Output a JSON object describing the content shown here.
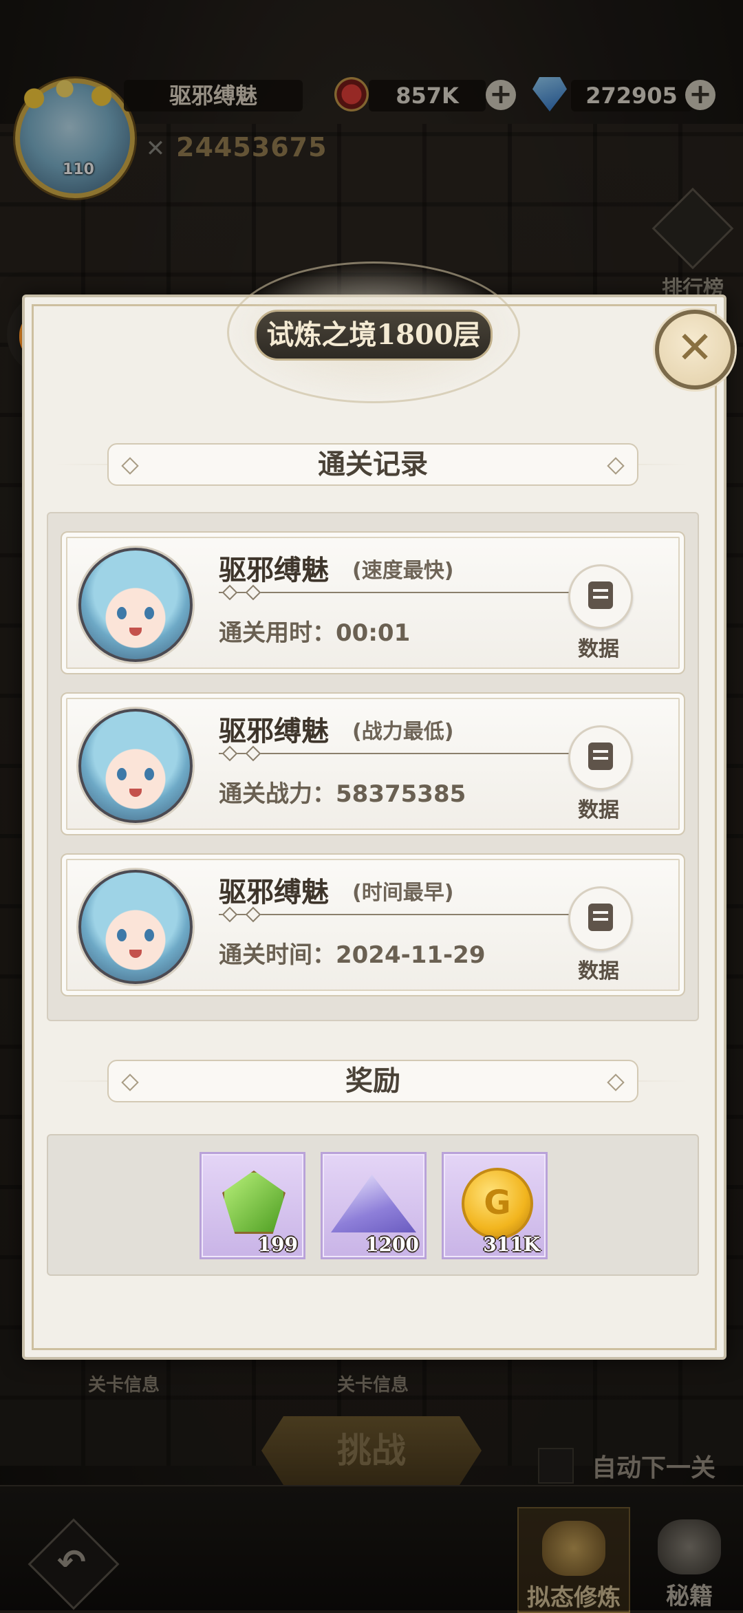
{
  "hud": {
    "player_name": "驱邪缚魅",
    "level": "110",
    "gold": "857K",
    "gems": "272905",
    "power": "24453675",
    "ranking_label": "排行榜"
  },
  "background": {
    "stage_info_1": "关卡信息",
    "stage_info_2": "关卡信息",
    "challenge_label": "挑战",
    "auto_next_label": "自动下一关",
    "tab_cultivation": "拟态修炼",
    "tab_secret": "秘籍"
  },
  "modal": {
    "title": "试炼之境1800层",
    "clear_records_header": "通关记录",
    "rewards_header": "奖励",
    "records": [
      {
        "name": "驱邪缚魅",
        "tag": "(速度最快)",
        "stat": "通关用时：00:01",
        "data_label": "数据"
      },
      {
        "name": "驱邪缚魅",
        "tag": "(战力最低)",
        "stat": "通关战力：58375385",
        "data_label": "数据"
      },
      {
        "name": "驱邪缚魅",
        "tag": "(时间最早)",
        "stat": "通关时间：2024-11-29",
        "data_label": "数据"
      }
    ],
    "rewards": [
      {
        "icon": "green-gem-icon",
        "count": "199"
      },
      {
        "icon": "crystal-dust-icon",
        "count": "1200"
      },
      {
        "icon": "gold-coin-icon",
        "count": "311K"
      }
    ]
  },
  "colors": {
    "modal_bg": "#f2efe8",
    "title_pill": "#2e2a24",
    "reward_bg": "#d8c8f0",
    "accent_gold": "#d9b24a"
  }
}
